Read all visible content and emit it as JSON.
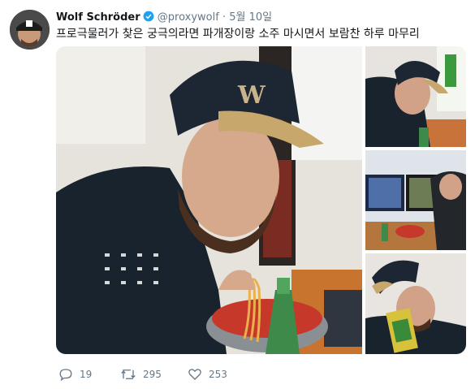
{
  "tweet": {
    "author_name": "Wolf Schröder",
    "handle": "@proxywolf",
    "separator": "·",
    "date": "5월 10일",
    "text": "프로극물러가 찾은 궁극의라면 파개장이랑 소주 마시면서 보람찬 하루 마무리"
  },
  "actions": {
    "reply_count": "19",
    "retweet_count": "295",
    "like_count": "253"
  },
  "colors": {
    "verified": "#1da1f2",
    "secondary_text": "#657786",
    "primary_text": "#14171a"
  },
  "icons": [
    "verified-badge-icon",
    "reply-icon",
    "retweet-icon",
    "like-icon"
  ]
}
